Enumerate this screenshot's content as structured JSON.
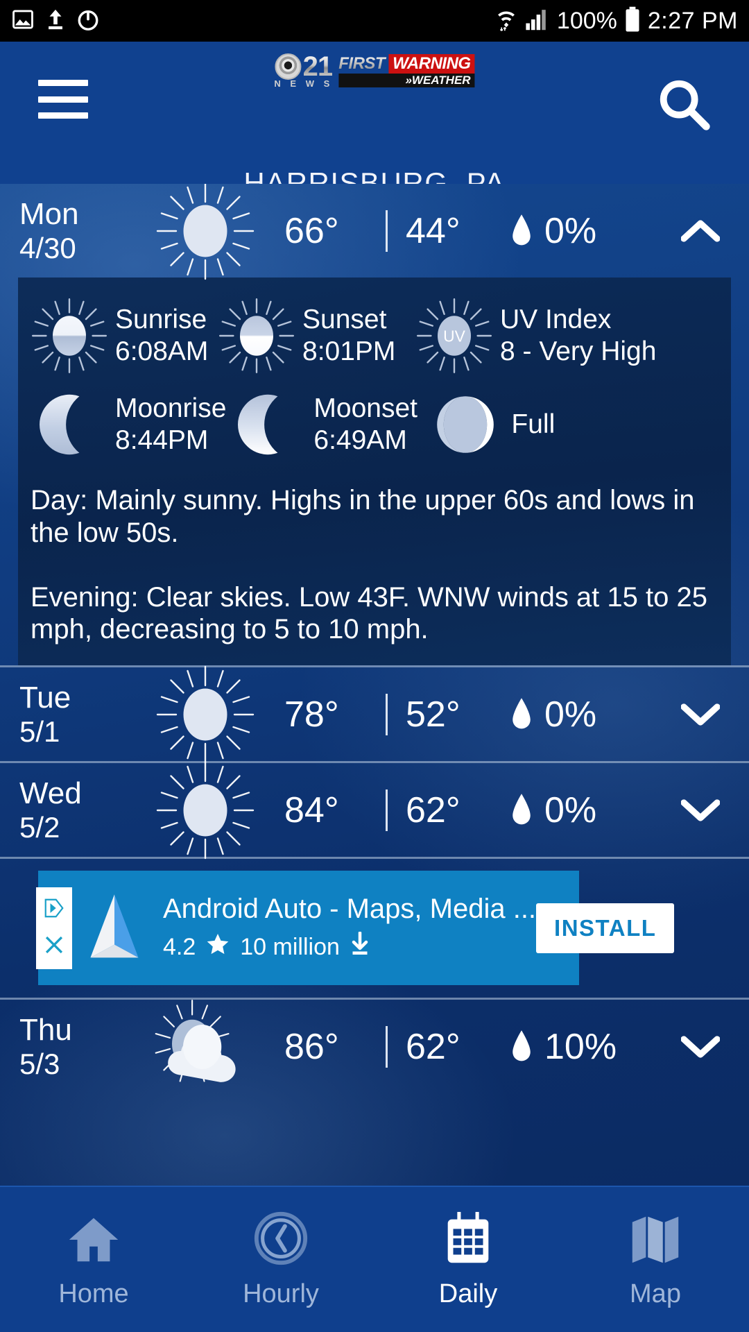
{
  "status_bar": {
    "left_icons": [
      "image-icon",
      "upload-icon",
      "timer-icon"
    ],
    "wifi_icon": "wifi-icon",
    "signal_icon": "cell-signal-icon",
    "battery_percent": "100%",
    "battery_icon": "battery-full-icon",
    "time": "2:27 PM"
  },
  "header": {
    "menu_icon": "hamburger-menu-icon",
    "search_icon": "search-icon",
    "logo": {
      "network": "21",
      "network_sub": "N E W S",
      "brand_first": "FIRST",
      "brand_warning": "WARNING",
      "brand_weather": "»WEATHER",
      "eye_icon": "cbs-eye-icon"
    },
    "city": "HARRISBURG, PA",
    "bg_color": "#10418f"
  },
  "forecast": {
    "days": [
      {
        "dow": "Mon",
        "date": "4/30",
        "icon": "sunny-icon",
        "high": "66°",
        "low": "44°",
        "separator": "|",
        "precip_icon": "water-drop-icon",
        "precip": "0%",
        "chevron": "chevron-up-icon",
        "expanded": true,
        "details": {
          "astro": [
            {
              "icon": "sunrise-icon",
              "label": "Sunrise",
              "value": "6:08AM"
            },
            {
              "icon": "sunset-icon",
              "label": "Sunset",
              "value": "8:01PM"
            },
            {
              "icon": "uv-index-icon",
              "label": "UV Index",
              "value": "8 - Very High"
            }
          ],
          "lunar": [
            {
              "icon": "moonrise-icon",
              "label": "Moonrise",
              "value": "8:44PM"
            },
            {
              "icon": "moonset-icon",
              "label": "Moonset",
              "value": "6:49AM"
            },
            {
              "icon": "moon-phase-full-icon",
              "label": "Full",
              "value": ""
            }
          ],
          "day_text": "Day: Mainly sunny. Highs in the upper 60s and lows in the low 50s.",
          "evening_text": "Evening: Clear skies. Low 43F. WNW winds at 15 to 25 mph, decreasing to 5 to 10 mph."
        }
      },
      {
        "dow": "Tue",
        "date": "5/1",
        "icon": "sunny-icon",
        "high": "78°",
        "low": "52°",
        "separator": "|",
        "precip_icon": "water-drop-icon",
        "precip": "0%",
        "chevron": "chevron-down-icon",
        "expanded": false
      },
      {
        "dow": "Wed",
        "date": "5/2",
        "icon": "sunny-icon",
        "high": "84°",
        "low": "62°",
        "separator": "|",
        "precip_icon": "water-drop-icon",
        "precip": "0%",
        "chevron": "chevron-down-icon",
        "expanded": false
      },
      {
        "dow": "Thu",
        "date": "5/3",
        "icon": "partly-cloudy-icon",
        "high": "86°",
        "low": "62°",
        "separator": "|",
        "precip_icon": "water-drop-icon",
        "precip": "10%",
        "chevron": "chevron-down-icon",
        "expanded": false
      }
    ]
  },
  "ad": {
    "title": "Android Auto - Maps, Media ...",
    "rating": "4.2",
    "star_icon": "star-icon",
    "downloads": "10 million",
    "download_icon": "download-icon",
    "install_label": "INSTALL",
    "adchoices_icon": "adchoices-icon",
    "close_icon": "close-x-icon",
    "app_icon": "android-auto-icon",
    "bg_color": "#0f81c2"
  },
  "bottom_nav": {
    "items": [
      {
        "label": "Home",
        "icon": "home-icon",
        "active": false
      },
      {
        "label": "Hourly",
        "icon": "clock-icon",
        "active": false
      },
      {
        "label": "Daily",
        "icon": "calendar-icon",
        "active": true
      },
      {
        "label": "Map",
        "icon": "map-icon",
        "active": false
      }
    ]
  }
}
